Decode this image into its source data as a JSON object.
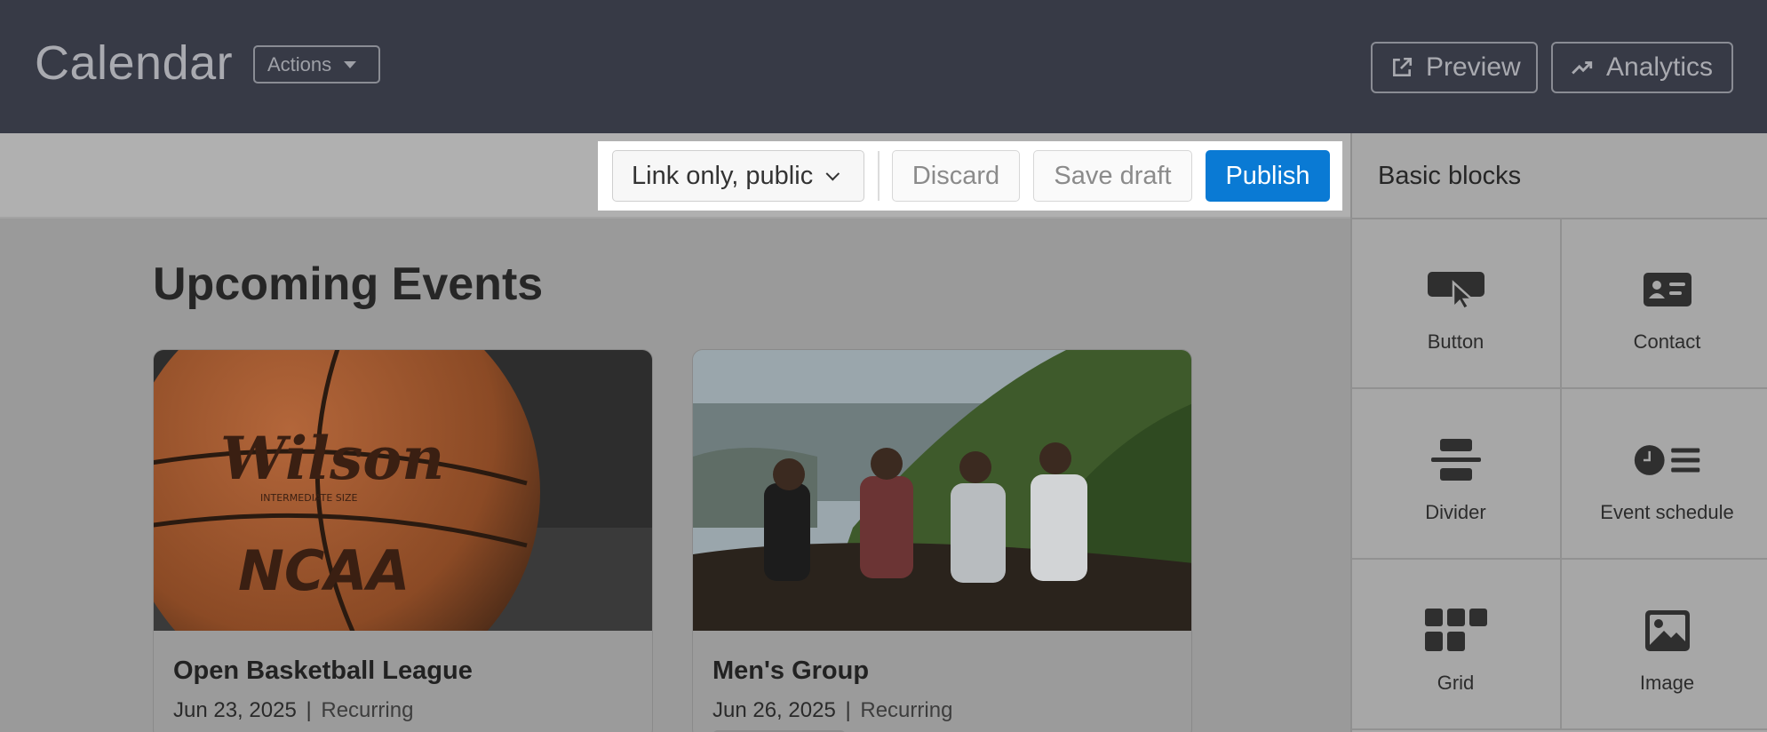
{
  "header": {
    "title": "Calendar",
    "actions_label": "Actions",
    "preview_label": "Preview",
    "analytics_label": "Analytics"
  },
  "toolbar": {
    "visibility_value": "Link only, public",
    "discard_label": "Discard",
    "save_draft_label": "Save draft",
    "publish_label": "Publish",
    "publish_color": "#0a7ad4"
  },
  "main": {
    "section_title": "Upcoming Events",
    "events": [
      {
        "title": "Open Basketball League",
        "date": "Jun 23, 2025",
        "separator": "|",
        "tag": "Recurring"
      },
      {
        "title": "Men's Group",
        "date": "Jun 26, 2025",
        "separator": "|",
        "tag": "Recurring"
      }
    ]
  },
  "panel": {
    "title": "Basic blocks",
    "blocks": [
      {
        "label": "Button",
        "icon": "button-cursor-icon"
      },
      {
        "label": "Contact",
        "icon": "contact-card-icon"
      },
      {
        "label": "Divider",
        "icon": "divider-icon"
      },
      {
        "label": "Event schedule",
        "icon": "event-schedule-icon"
      },
      {
        "label": "Grid",
        "icon": "grid-icon"
      },
      {
        "label": "Image",
        "icon": "image-icon"
      }
    ]
  }
}
